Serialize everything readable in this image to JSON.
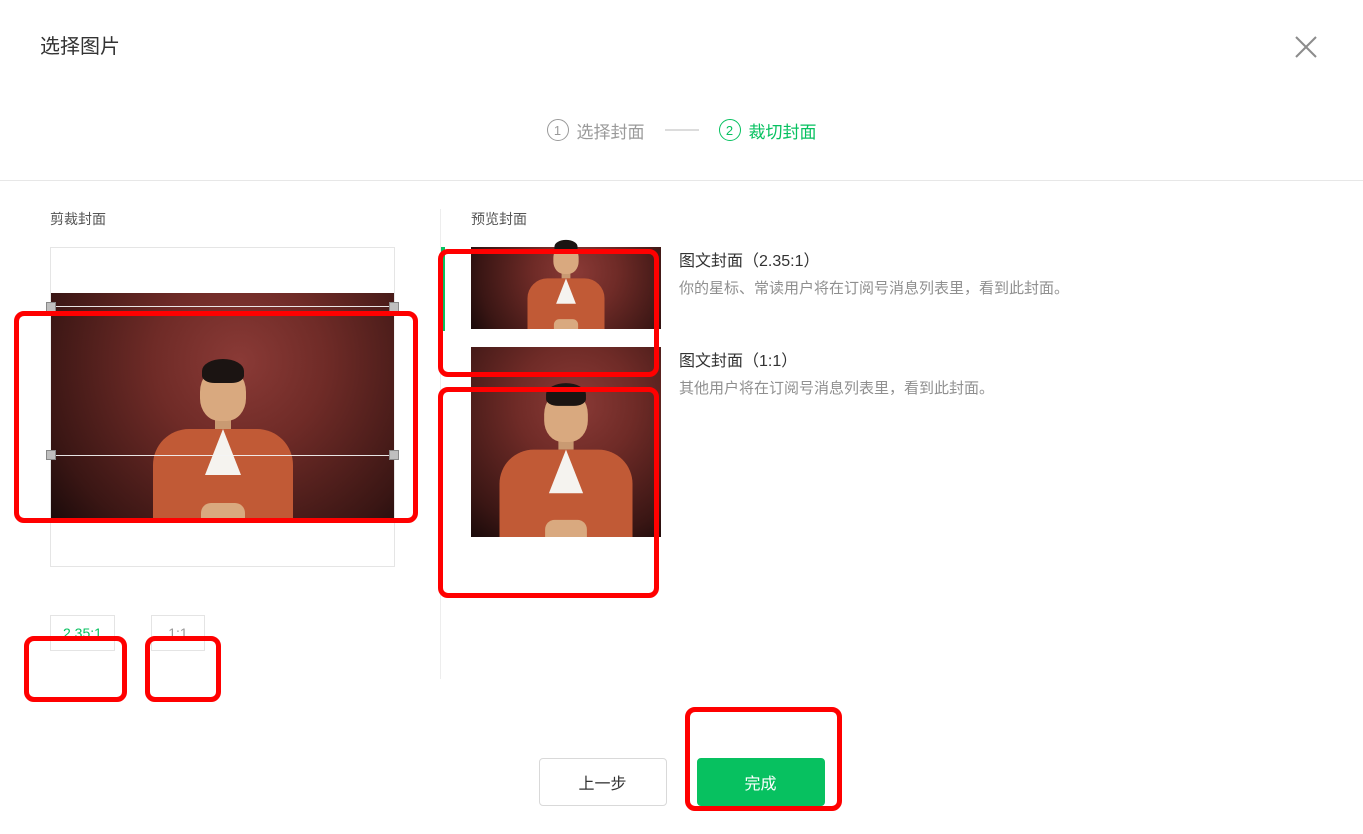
{
  "dialog": {
    "title": "选择图片"
  },
  "stepper": {
    "step1": {
      "num": "1",
      "label": "选择封面"
    },
    "step2": {
      "num": "2",
      "label": "裁切封面"
    }
  },
  "crop": {
    "heading": "剪裁封面",
    "ratios": {
      "r235": "2.35:1",
      "r11": "1:1"
    }
  },
  "preview": {
    "heading": "预览封面",
    "items": [
      {
        "title": "图文封面（2.35:1）",
        "desc": "你的星标、常读用户将在订阅号消息列表里，看到此封面。"
      },
      {
        "title": "图文封面（1:1）",
        "desc": "其他用户将在订阅号消息列表里，看到此封面。"
      }
    ]
  },
  "footer": {
    "prev": "上一步",
    "done": "完成"
  }
}
